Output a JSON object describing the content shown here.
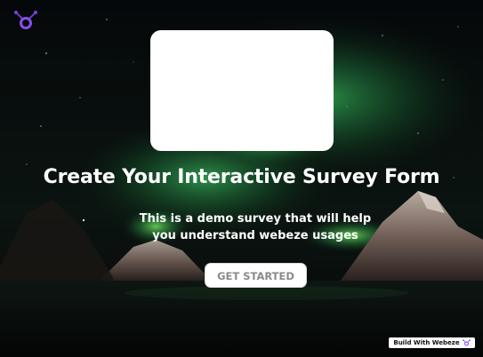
{
  "brand": {
    "logo_icon": "webeze-logo-icon",
    "accent_color": "#7b3fe4"
  },
  "hero": {
    "media_placeholder": "white-image-card",
    "title": "Create Your Interactive Survey Form",
    "subtitle": "This is a demo survey that will help you understand webeze usages",
    "cta_label": "GET STARTED"
  },
  "footer_badge": {
    "label": "Build With Webeze",
    "icon": "webeze-logo-icon"
  },
  "background": {
    "scene": "aurora-night-sky-mountains",
    "aurora_color": "#3fd66a",
    "sky_color": "#060a0c"
  }
}
